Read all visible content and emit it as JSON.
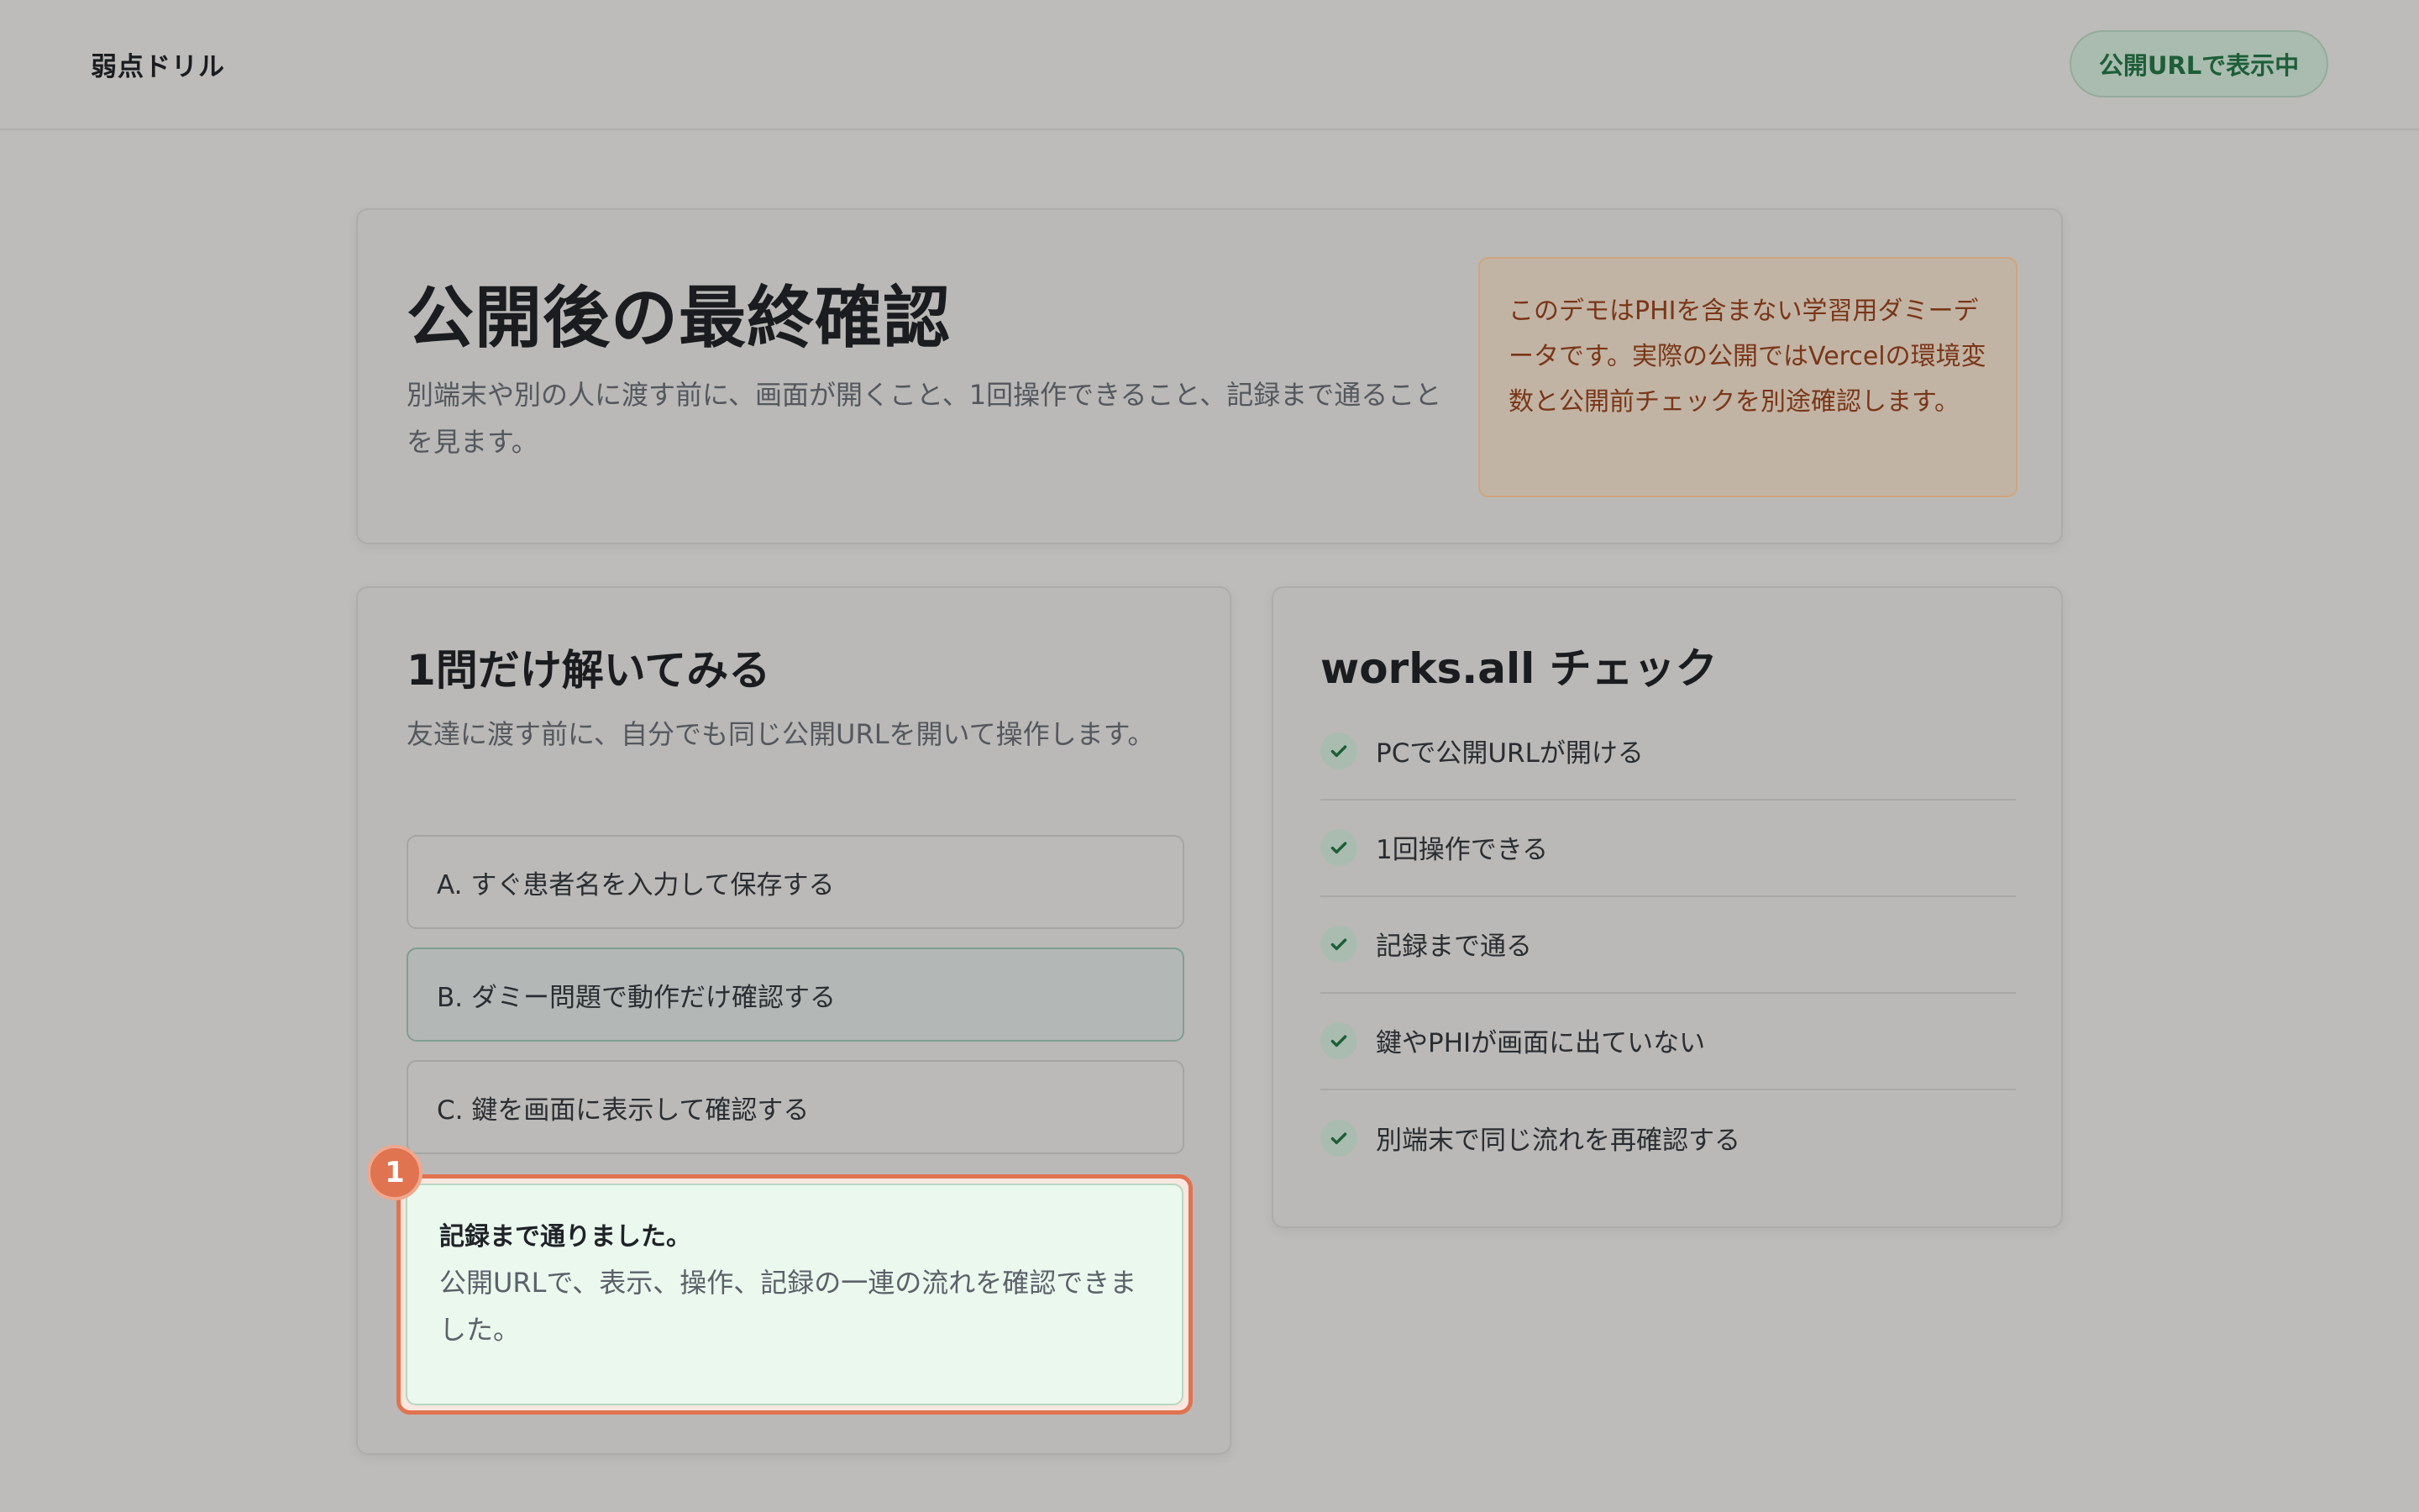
{
  "header": {
    "brand": "弱点ドリル",
    "status": "公開URLで表示中"
  },
  "hero": {
    "title": "公開後の最終確認",
    "description": "別端末や別の人に渡す前に、画面が開くこと、1回操作できること、記録まで通ることを見ます。",
    "notice": "このデモはPHIを含まない学習用ダミーデータです。実際の公開ではVercelの環境変数と公開前チェックを別途確認します。"
  },
  "quiz": {
    "title": "1問だけ解いてみる",
    "description": "友達に渡す前に、自分でも同じ公開URLを開いて操作します。",
    "options": [
      {
        "label": "A. すぐ患者名を入力して保存する",
        "selected": false
      },
      {
        "label": "B. ダミー問題で動作だけ確認する",
        "selected": true
      },
      {
        "label": "C. 鍵を画面に表示して確認する",
        "selected": false
      }
    ],
    "result": {
      "step": "1",
      "title": "記録まで通りました。",
      "description": "公開URLで、表示、操作、記録の一連の流れを確認できました。"
    }
  },
  "checklist": {
    "title": "works.all チェック",
    "icon": "check-icon",
    "items": [
      {
        "label": "PCで公開URLが開ける"
      },
      {
        "label": "1回操作できる"
      },
      {
        "label": "記録まで通る"
      },
      {
        "label": "鍵やPHIが画面に出ていない"
      },
      {
        "label": "別端末で同じ流れを再確認する"
      }
    ]
  },
  "colors": {
    "accent": "#e07350",
    "success": "#1d5e38",
    "notice_text": "#7a3618"
  }
}
